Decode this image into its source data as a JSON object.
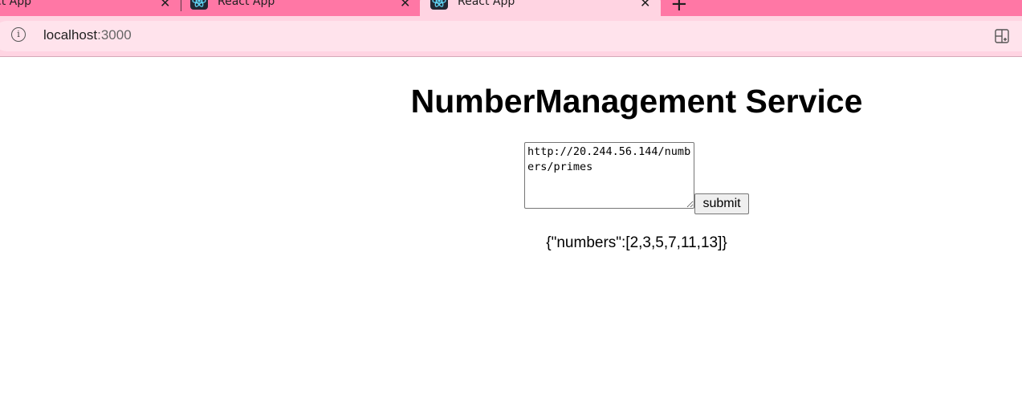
{
  "browser": {
    "tabs": [
      {
        "title": "ct App",
        "active": false
      },
      {
        "title": "React App",
        "active": false
      },
      {
        "title": "React App",
        "active": true
      }
    ],
    "close_glyph": "✕",
    "new_tab_glyph": "+",
    "address_bar": {
      "host": "localhost",
      "port": ":3000"
    },
    "colors": {
      "tab_strip": "#ff77a5",
      "toolbar": "#ffd4e2",
      "omnibox": "#ffe3ec"
    }
  },
  "page": {
    "title": "NumberManagement Service",
    "url_input_value": "http://20.244.56.144/numbers/primes",
    "submit_label": "submit",
    "result_text": "{\"numbers\":[2,3,5,7,11,13]}"
  }
}
